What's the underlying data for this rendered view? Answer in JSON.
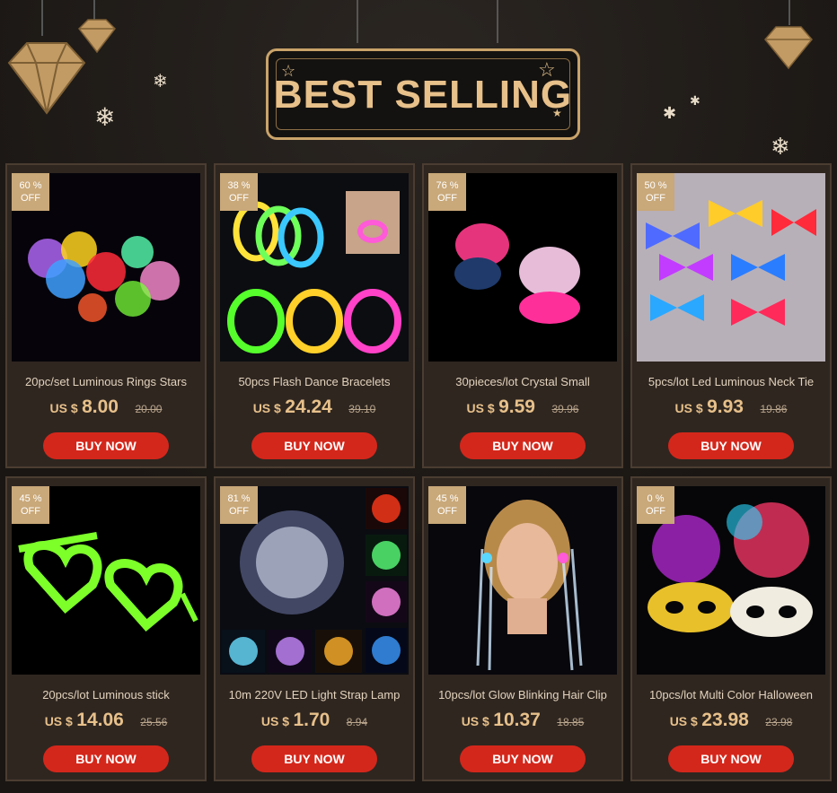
{
  "banner": {
    "title": "BEST SELLING"
  },
  "products": [
    {
      "badge_pct": "60 %",
      "badge_off": "OFF",
      "title": "20pc/set Luminous Rings Stars",
      "currency": "US $",
      "price": "8.00",
      "old_price": "20.00",
      "button": "BUY NOW",
      "photo": "flashing-rings"
    },
    {
      "badge_pct": "38 %",
      "badge_off": "OFF",
      "title": "50pcs Flash Dance Bracelets",
      "currency": "US $",
      "price": "24.24",
      "old_price": "39.10",
      "button": "BUY NOW",
      "photo": "glow-bracelets"
    },
    {
      "badge_pct": "76 %",
      "badge_off": "OFF",
      "title": "30pieces/lot Crystal Small",
      "currency": "US $",
      "price": "9.59",
      "old_price": "39.96",
      "button": "BUY NOW",
      "photo": "crystal-rings"
    },
    {
      "badge_pct": "50 %",
      "badge_off": "OFF",
      "title": "5pcs/lot Led Luminous Neck Tie",
      "currency": "US $",
      "price": "9.93",
      "old_price": "19.86",
      "button": "BUY NOW",
      "photo": "led-bow-ties"
    },
    {
      "badge_pct": "45 %",
      "badge_off": "OFF",
      "title": "20pcs/lot Luminous stick",
      "currency": "US $",
      "price": "14.06",
      "old_price": "25.56",
      "button": "BUY NOW",
      "photo": "heart-glasses"
    },
    {
      "badge_pct": "81 %",
      "badge_off": "OFF",
      "title": "10m 220V LED Light Strap Lamp",
      "currency": "US $",
      "price": "1.70",
      "old_price": "8.94",
      "button": "BUY NOW",
      "photo": "led-string-lights"
    },
    {
      "badge_pct": "45 %",
      "badge_off": "OFF",
      "title": "10pcs/lot Glow Blinking Hair Clip",
      "currency": "US $",
      "price": "10.37",
      "old_price": "18.85",
      "button": "BUY NOW",
      "photo": "hair-clip-model"
    },
    {
      "badge_pct": "0 %",
      "badge_off": "OFF",
      "title": "10pcs/lot Multi Color Halloween",
      "currency": "US $",
      "price": "23.98",
      "old_price": "23.98",
      "button": "BUY NOW",
      "photo": "feather-masks"
    }
  ],
  "colors": {
    "accent_gold": "#e7c08a",
    "button_red": "#d4271b",
    "card_bg": "#2f2620"
  }
}
